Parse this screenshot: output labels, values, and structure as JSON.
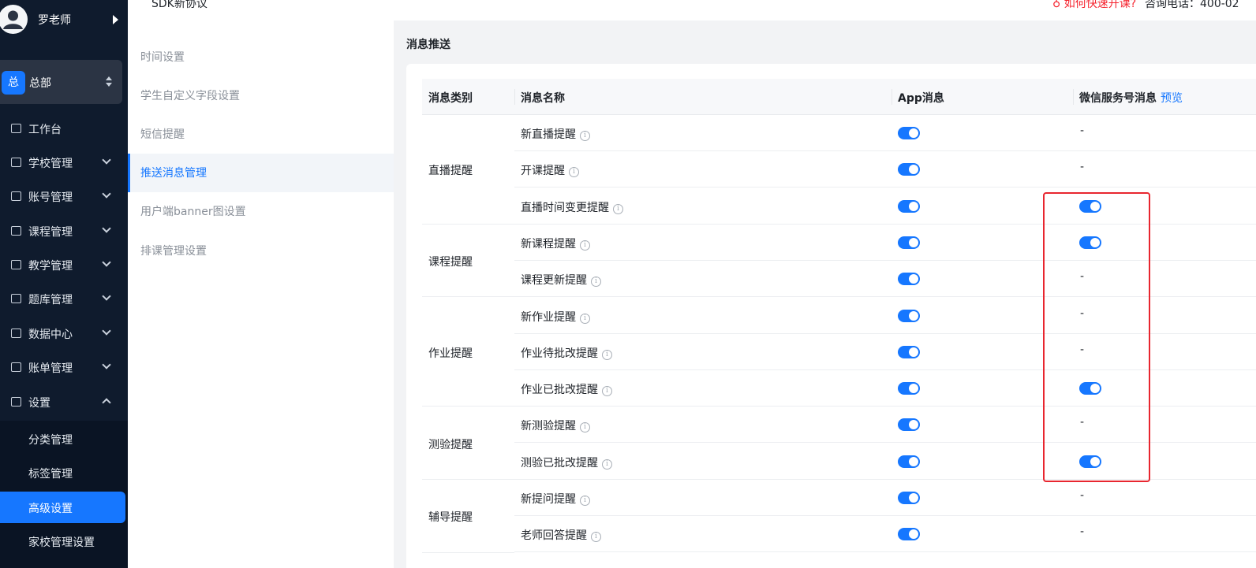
{
  "user": {
    "name": "罗老师"
  },
  "org": {
    "badge": "总",
    "name": "总部"
  },
  "nav": [
    {
      "label": "工作台",
      "icon": "dashboard-icon",
      "chevron": "none"
    },
    {
      "label": "学校管理",
      "icon": "school-icon",
      "chevron": "down"
    },
    {
      "label": "账号管理",
      "icon": "users-icon",
      "chevron": "down"
    },
    {
      "label": "课程管理",
      "icon": "course-icon",
      "chevron": "down"
    },
    {
      "label": "教学管理",
      "icon": "teaching-icon",
      "chevron": "down"
    },
    {
      "label": "题库管理",
      "icon": "question-bank-icon",
      "chevron": "down"
    },
    {
      "label": "数据中心",
      "icon": "data-chart-icon",
      "chevron": "down"
    },
    {
      "label": "账单管理",
      "icon": "bill-icon",
      "chevron": "down"
    },
    {
      "label": "设置",
      "icon": "settings-grid-icon",
      "chevron": "up"
    }
  ],
  "settings_submenu": [
    {
      "label": "分类管理",
      "active": false
    },
    {
      "label": "标签管理",
      "active": false
    },
    {
      "label": "高级设置",
      "active": true
    },
    {
      "label": "家校管理设置",
      "active": false
    }
  ],
  "topbar": {
    "title": "SDK新协议",
    "help_link": "♁ 如何快速开课?",
    "phone": "咨询电话：400-02"
  },
  "secondary_menu": [
    {
      "label": "时间设置",
      "active": false
    },
    {
      "label": "学生自定义字段设置",
      "active": false
    },
    {
      "label": "短信提醒",
      "active": false
    },
    {
      "label": "推送消息管理",
      "active": true
    },
    {
      "label": "用户端banner图设置",
      "active": false
    },
    {
      "label": "排课管理设置",
      "active": false
    }
  ],
  "main": {
    "section_title": "消息推送",
    "columns": {
      "category": "消息类别",
      "name": "消息名称",
      "app": "App消息",
      "wechat": "微信服务号消息",
      "preview": "预览"
    },
    "categories": [
      {
        "label": "直播提醒",
        "rows": 3
      },
      {
        "label": "课程提醒",
        "rows": 2
      },
      {
        "label": "作业提醒",
        "rows": 3
      },
      {
        "label": "测验提醒",
        "rows": 2
      },
      {
        "label": "辅导提醒",
        "rows": 2
      }
    ],
    "rows": [
      {
        "name": "新直播提醒",
        "app_on": true,
        "wechat": "-"
      },
      {
        "name": "开课提醒",
        "app_on": true,
        "wechat": "-"
      },
      {
        "name": "直播时间变更提醒",
        "app_on": true,
        "wechat": "on"
      },
      {
        "name": "新课程提醒",
        "app_on": true,
        "wechat": "on"
      },
      {
        "name": "课程更新提醒",
        "app_on": true,
        "wechat": "-"
      },
      {
        "name": "新作业提醒",
        "app_on": true,
        "wechat": "-"
      },
      {
        "name": "作业待批改提醒",
        "app_on": true,
        "wechat": "-"
      },
      {
        "name": "作业已批改提醒",
        "app_on": true,
        "wechat": "on"
      },
      {
        "name": "新测验提醒",
        "app_on": true,
        "wechat": "-"
      },
      {
        "name": "测验已批改提醒",
        "app_on": true,
        "wechat": "on"
      },
      {
        "name": "新提问提醒",
        "app_on": true,
        "wechat": "-"
      },
      {
        "name": "老师回答提醒",
        "app_on": true,
        "wechat": "-"
      }
    ]
  },
  "colors": {
    "accent": "#1677ff",
    "sidebar": "#0f1b2d",
    "highlight": "#e8262f"
  }
}
